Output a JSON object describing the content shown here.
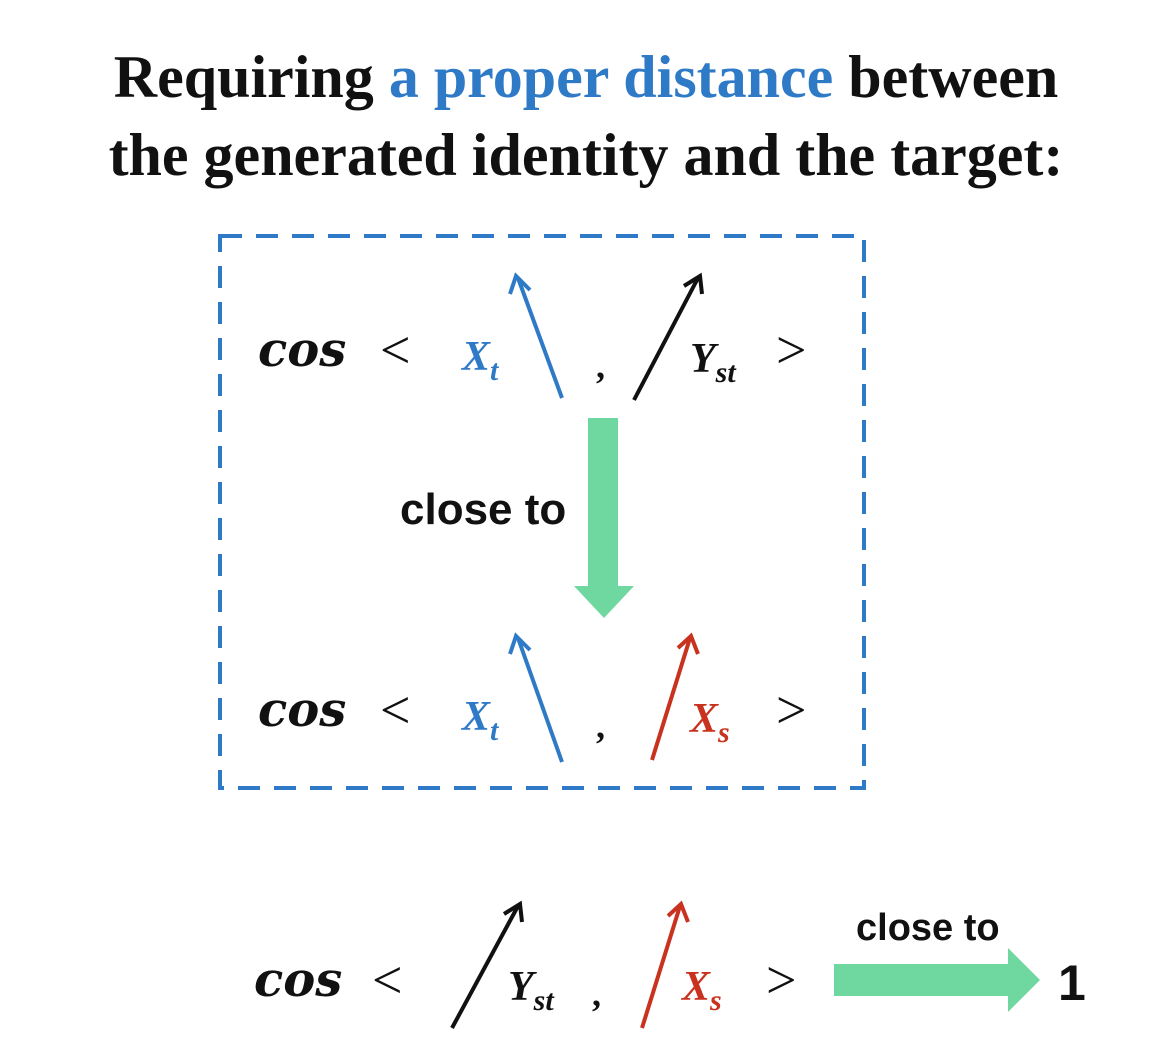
{
  "title": {
    "line1_prefix": "Requiring ",
    "line1_highlight": "a proper distance",
    "line1_suffix": " between",
    "line2": "the generated identity and the target:"
  },
  "colors": {
    "highlight": "#2f7ac6",
    "blue_vector": "#2f7ac6",
    "black_vector": "#111111",
    "red_vector": "#c8321e",
    "arrow_green": "#6fd7a0",
    "dashed_box": "#2f7ac6"
  },
  "expressions": {
    "cos": "cos",
    "lt": "<",
    "gt": ">",
    "comma": ",",
    "row1": {
      "a": "X",
      "a_sub": "t",
      "b": "Y",
      "b_sub": "st"
    },
    "row2": {
      "a": "X",
      "a_sub": "t",
      "b": "X",
      "b_sub": "s"
    },
    "row3": {
      "a": "Y",
      "a_sub": "st",
      "b": "X",
      "b_sub": "s"
    }
  },
  "labels": {
    "close_to_vertical": "close to",
    "close_to_horizontal": "close to",
    "result": "1"
  }
}
